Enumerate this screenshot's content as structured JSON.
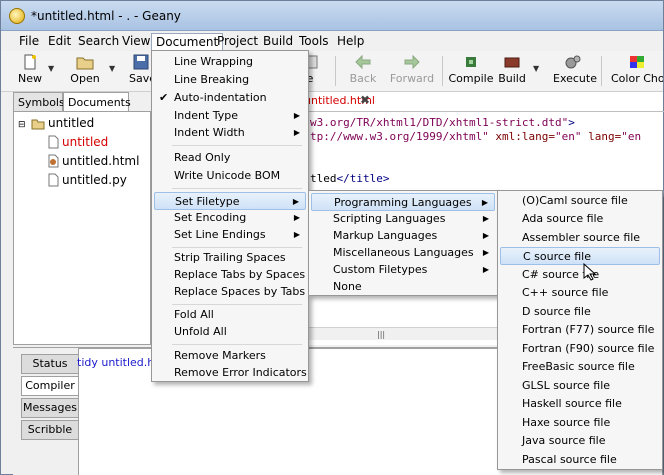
{
  "window": {
    "title": "*untitled.html - . - Geany"
  },
  "menubar": [
    "File",
    "Edit",
    "Search",
    "View",
    "Document",
    "Project",
    "Build",
    "Tools",
    "Help"
  ],
  "toolbar": {
    "new": "New",
    "open": "Open",
    "save": "Save",
    "back": "Back",
    "forward": "Forward",
    "compile": "Compile",
    "build": "Build",
    "execute": "Execute",
    "color": "Color Cho"
  },
  "sidebar": {
    "tabs": [
      "Symbols",
      "Documents"
    ],
    "tree": {
      "folder": "untitled",
      "files": [
        "untitled",
        "untitled.html",
        "untitled.py"
      ]
    }
  },
  "editor": {
    "tab_label": "untitled.html",
    "lines": [
      {
        "a": "w3.org/TR/xhtml1/DTD/xhtml1-strict.dtd\"",
        "b": ">"
      },
      {
        "a": "tp://www.w3.org/1999/xhtml\"",
        "b": " xml:lang=",
        "c": "\"en\"",
        "d": " lang=",
        "e": "\"en"
      },
      {
        "a": "tled",
        "b": "</title>"
      }
    ]
  },
  "bottom_panel": {
    "tabs": [
      "Status",
      "Compiler",
      "Messages",
      "Scribble"
    ],
    "compiler_text": "tidy untitled.htm"
  },
  "document_menu": {
    "items": [
      "Line Wrapping",
      "Line Breaking",
      "Auto-indentation",
      "Indent Type",
      "Indent Width",
      "Read Only",
      "Write Unicode BOM",
      "Set Filetype",
      "Set Encoding",
      "Set Line Endings",
      "Strip Trailing Spaces",
      "Replace Tabs by Spaces",
      "Replace Spaces by Tabs",
      "Fold All",
      "Unfold All",
      "Remove Markers",
      "Remove Error Indicators"
    ],
    "checked": "Auto-indentation"
  },
  "filetype_menu": {
    "items": [
      "Programming Languages",
      "Scripting Languages",
      "Markup Languages",
      "Miscellaneous Languages",
      "Custom Filetypes",
      "None"
    ]
  },
  "languages_menu": {
    "items": [
      "(O)Caml source file",
      "Ada source file",
      "Assembler source file",
      "C source file",
      "C# source file",
      "C++ source file",
      "D source file",
      "Fortran (F77) source file",
      "Fortran (F90) source file",
      "FreeBasic source file",
      "GLSL source file",
      "Haskell source file",
      "Haxe source file",
      "Java source file",
      "Pascal source file"
    ]
  }
}
